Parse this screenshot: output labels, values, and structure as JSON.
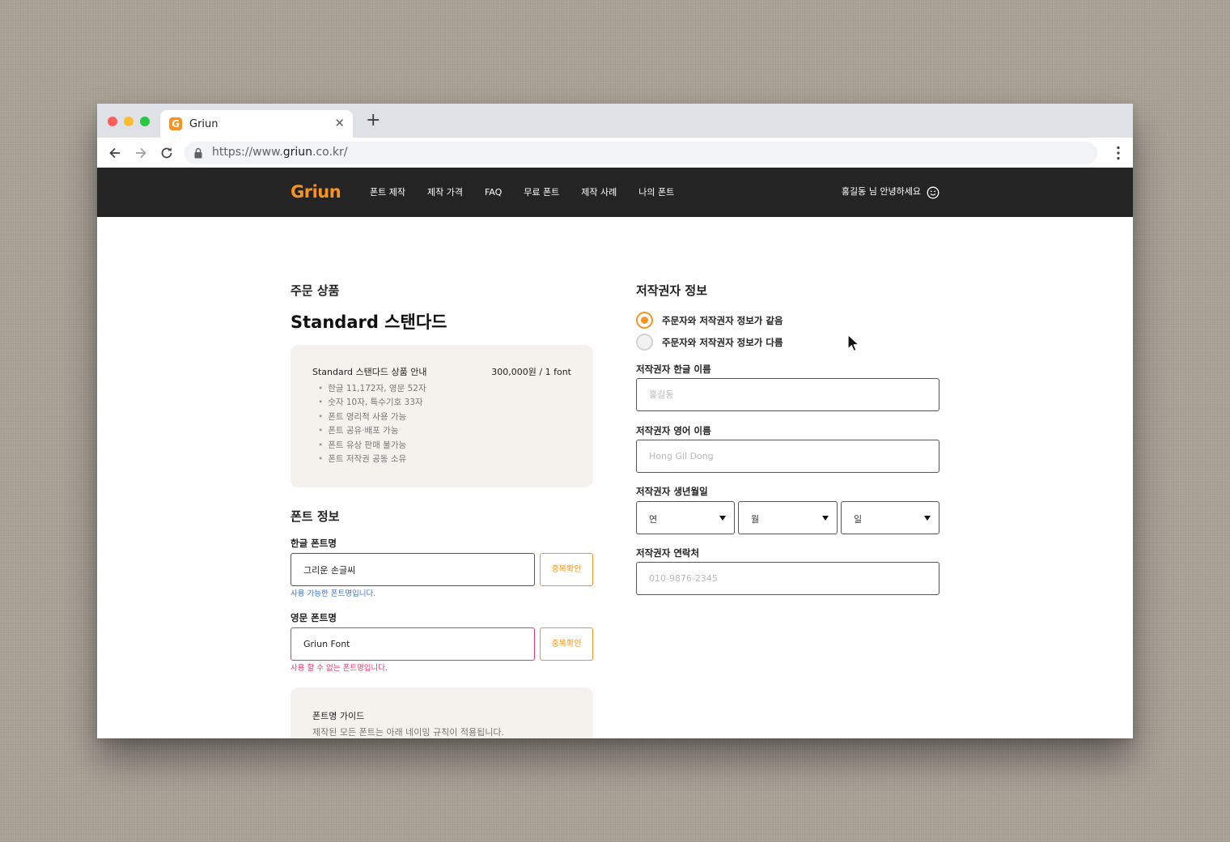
{
  "browser": {
    "tab_title": "Griun",
    "favicon_letter": "G",
    "url_prefix": "https://www.",
    "url_host": "griun",
    "url_suffix": ".co.kr/"
  },
  "header": {
    "logo": "Griun",
    "nav": [
      "폰트 제작",
      "제작 가격",
      "FAQ",
      "무료 폰트",
      "제작 사례",
      "나의 폰트"
    ],
    "greeting": "홍길동 님 안녕하세요",
    "brand_color": "#f7931e"
  },
  "order": {
    "section_title": "주문 상품",
    "product_title": "Standard 스탠다드",
    "product_name": "Standard 스탠다드 상품 안내",
    "price": "300,000원 / 1 font",
    "features": [
      "한글 11,172자, 영문 52자",
      "숫자 10자, 특수기호 33자",
      "폰트 영리적 사용 가능",
      "폰트 공유·배포 가능",
      "폰트 유상 판매 불가능",
      "폰트 저작권 공동 소유"
    ]
  },
  "font_info": {
    "section_title": "폰트 정보",
    "korean_label": "한글 폰트명",
    "korean_value": "그리운 손글씨",
    "korean_msg": "사용 가능한 폰트명입니다.",
    "english_label": "영문 폰트명",
    "english_value": "Griun Font",
    "english_msg": "사용 할 수 없는 폰트명입니다.",
    "dup_button": "중복확인",
    "guide_title": "폰트명 가이드",
    "guide_text": "제작된 모든 폰트는 아래 네이밍 규칙이 적용됩니다."
  },
  "author": {
    "section_title": "저작권자 정보",
    "radio_same": "주문자와 저작권자 정보가 같음",
    "radio_diff": "주문자와 저작권자 정보가 다름",
    "selected": "same",
    "korean_name_label": "저작권자 한글 이름",
    "korean_name_placeholder": "홍길동",
    "english_name_label": "저작권자 영어 이름",
    "english_name_placeholder": "Hong Gil Dong",
    "birth_label": "저작권자 생년월일",
    "birth_year": "연",
    "birth_month": "월",
    "birth_day": "일",
    "contact_label": "저작권자 연락처",
    "contact_placeholder": "010-9876-2345"
  },
  "icons": [
    "back-arrow-icon",
    "forward-arrow-icon",
    "reload-icon",
    "lock-icon",
    "more-vert-icon",
    "smile-icon",
    "chevron-down-icon",
    "mouse-cursor-icon"
  ]
}
